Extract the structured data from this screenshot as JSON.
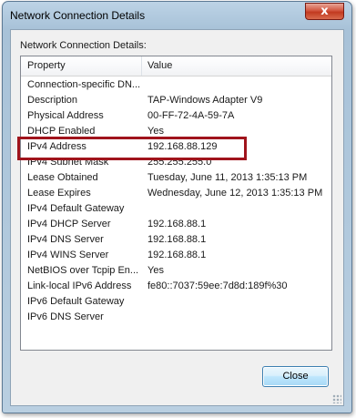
{
  "window": {
    "title": "Network Connection Details",
    "close_glyph": "x"
  },
  "dialog": {
    "label": "Network Connection Details:",
    "columns": [
      "Property",
      "Value"
    ],
    "rows": [
      {
        "property": "Connection-specific DN...",
        "value": ""
      },
      {
        "property": "Description",
        "value": "TAP-Windows Adapter V9"
      },
      {
        "property": "Physical Address",
        "value": "00-FF-72-4A-59-7A"
      },
      {
        "property": "DHCP Enabled",
        "value": "Yes"
      },
      {
        "property": "IPv4 Address",
        "value": "192.168.88.129"
      },
      {
        "property": "IPv4 Subnet Mask",
        "value": "255.255.255.0"
      },
      {
        "property": "Lease Obtained",
        "value": "Tuesday, June 11, 2013 1:35:13 PM"
      },
      {
        "property": "Lease Expires",
        "value": "Wednesday, June 12, 2013 1:35:13 PM"
      },
      {
        "property": "IPv4 Default Gateway",
        "value": ""
      },
      {
        "property": "IPv4 DHCP Server",
        "value": "192.168.88.1"
      },
      {
        "property": "IPv4 DNS Server",
        "value": "192.168.88.1"
      },
      {
        "property": "IPv4 WINS Server",
        "value": "192.168.88.1"
      },
      {
        "property": "NetBIOS over Tcpip En...",
        "value": "Yes"
      },
      {
        "property": "Link-local IPv6 Address",
        "value": "fe80::7037:59ee:7d8d:189f%30"
      },
      {
        "property": "IPv6 Default Gateway",
        "value": ""
      },
      {
        "property": "IPv6 DNS Server",
        "value": ""
      }
    ],
    "highlighted_row": "IPv4 Address",
    "close_button": "Close"
  },
  "colors": {
    "highlight_border": "#a0141c",
    "window_frame": "#a8c2d8",
    "close_button_red": "#c23a20"
  }
}
